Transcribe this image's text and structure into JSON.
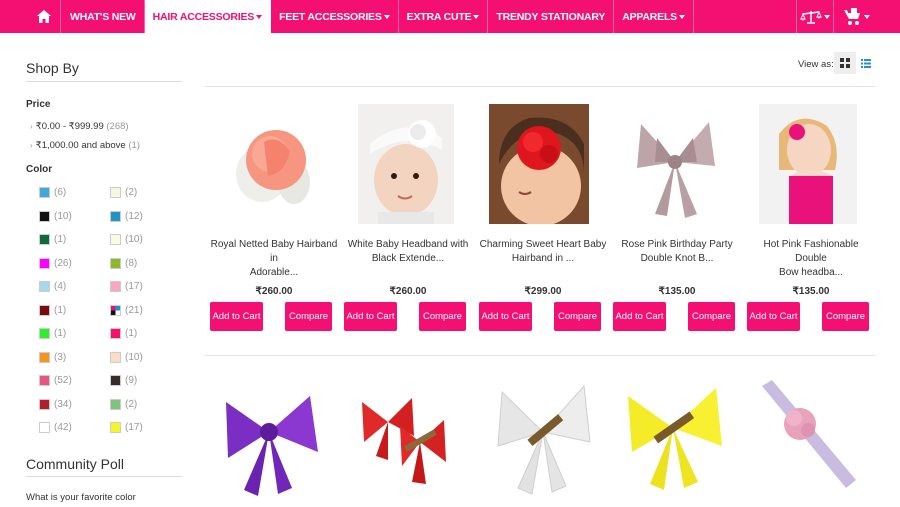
{
  "nav": {
    "items": [
      {
        "label": "WHAT'S NEW",
        "dropdown": false,
        "active": false
      },
      {
        "label": "HAIR ACCESSORIES",
        "dropdown": true,
        "active": true
      },
      {
        "label": "FEET ACCESSORIES",
        "dropdown": true,
        "active": false
      },
      {
        "label": "EXTRA CUTE",
        "dropdown": true,
        "active": false
      },
      {
        "label": "TRENDY STATIONARY",
        "dropdown": false,
        "active": false
      },
      {
        "label": "APPARELS",
        "dropdown": true,
        "active": false
      }
    ],
    "icons": [
      "home-icon",
      "compare-scale-icon",
      "cart-icon"
    ],
    "colors": {
      "brand": "#f40f73"
    }
  },
  "sidebar": {
    "shop_by": "Shop By",
    "price_label": "Price",
    "price_items": [
      {
        "range": "₹0.00 - ₹999.99",
        "count": "(268)"
      },
      {
        "range": "₹1,000.00 and above",
        "count": "(1)"
      }
    ],
    "color_label": "Color",
    "colors": [
      {
        "hex": "#3fa9dc",
        "count": "(6)"
      },
      {
        "hex": "#f7f7e0",
        "count": "(2)"
      },
      {
        "hex": "#111111",
        "count": "(10)"
      },
      {
        "hex": "#2193c4",
        "count": "(12)"
      },
      {
        "hex": "#0b6b3a",
        "count": "(1)"
      },
      {
        "hex": "#fbfbe2",
        "count": "(10)"
      },
      {
        "hex": "#ff00ff",
        "count": "(26)"
      },
      {
        "hex": "#8db82a",
        "count": "(8)"
      },
      {
        "hex": "#a6d8ec",
        "count": "(4)"
      },
      {
        "hex": "#f7a8c0",
        "count": "(17)"
      },
      {
        "hex": "#7a0b0b",
        "count": "(1)"
      },
      {
        "hex": "multi",
        "count": "(21)"
      },
      {
        "hex": "#2bf02b",
        "count": "(1)"
      },
      {
        "hex": "#f2116b",
        "count": "(1)"
      },
      {
        "hex": "#f7941d",
        "count": "(3)"
      },
      {
        "hex": "#fcdcc4",
        "count": "(10)"
      },
      {
        "hex": "#e8557e",
        "count": "(52)"
      },
      {
        "hex": "#3b2a2a",
        "count": "(9)"
      },
      {
        "hex": "#b51d2a",
        "count": "(34)"
      },
      {
        "hex": "#7ec37e",
        "count": "(2)"
      },
      {
        "hex": "#ffffff",
        "count": "(42)"
      },
      {
        "hex": "#f8f526",
        "count": "(17)"
      }
    ],
    "poll_title": "Community Poll",
    "poll_question": "What is your favorite color"
  },
  "main": {
    "view_as": "View as:",
    "view_icons": [
      "grid-view-icon",
      "list-view-icon"
    ],
    "add_to_cart": "Add to Cart",
    "compare": "Compare",
    "products": [
      {
        "name_line1": "Royal Netted Baby Hairband in",
        "name_line2": "Adorable...",
        "price": "₹260.00"
      },
      {
        "name_line1": "White Baby Headband with",
        "name_line2": "Black Extende...",
        "price": "₹260.00"
      },
      {
        "name_line1": "Charming Sweet Heart Baby",
        "name_line2": "Hairband in ...",
        "price": "₹299.00"
      },
      {
        "name_line1": "Rose Pink Birthday Party",
        "name_line2": "Double Knot B...",
        "price": "₹135.00"
      },
      {
        "name_line1": "Hot Pink Fashionable Double",
        "name_line2": "Bow headba...",
        "price": "₹135.00"
      }
    ],
    "row2_products": [
      "purple-bow",
      "red-bows",
      "white-bow",
      "yellow-bow",
      "lavender-headband"
    ]
  }
}
